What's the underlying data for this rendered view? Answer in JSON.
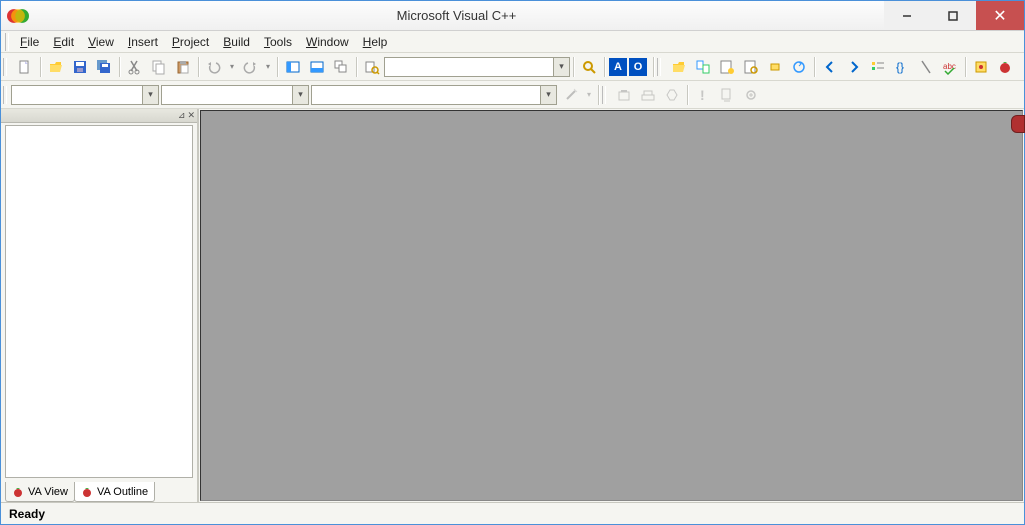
{
  "title": "Microsoft Visual C++",
  "menu": [
    "File",
    "Edit",
    "View",
    "Insert",
    "Project",
    "Build",
    "Tools",
    "Window",
    "Help"
  ],
  "sideTabs": [
    {
      "label": "VA View",
      "active": false
    },
    {
      "label": "VA Outline",
      "active": true
    }
  ],
  "status": "Ready",
  "boxes": {
    "a": "A",
    "o": "O"
  }
}
